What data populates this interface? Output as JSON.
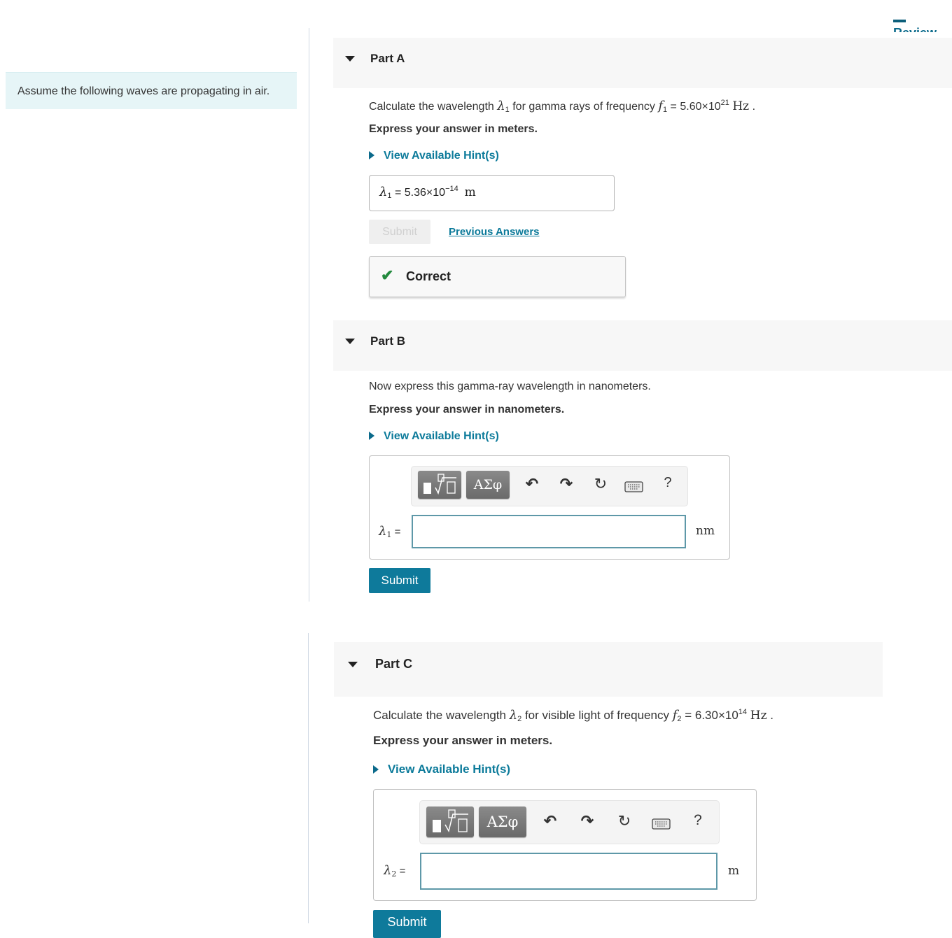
{
  "header": {
    "review_link": "Review"
  },
  "intro": {
    "text": "Assume the following waves are propagating in air."
  },
  "icons": {
    "expanded": "triangle-down",
    "hint": "triangle-right",
    "check": "✔",
    "templates": "fraction-root-template",
    "symbols": "ΑΣφ",
    "undo": "↶",
    "redo": "↷",
    "reset": "↻",
    "keyboard": "keyboard",
    "help": "?"
  },
  "colors": {
    "accent": "#0e7a9b",
    "correct": "#238a3e",
    "intro_bg": "#e6f5f7"
  },
  "parts": [
    {
      "title": "Part A",
      "question_pre": "Calculate the wavelength ",
      "var": "λ",
      "var_sub": "1",
      "question_mid": " for gamma rays of frequency ",
      "freq_var": "f",
      "freq_sub": "1",
      "freq_eq": " = 5.60×10",
      "freq_exp": "21",
      "freq_unit": "Hz",
      "question_end": " .",
      "instruction": "Express your answer in meters.",
      "hint_label": "View Available Hint(s)",
      "answer": {
        "label": "λ",
        "label_sub": "1",
        "eq": " = ",
        "mantissa": "5.36×10",
        "exponent": "−14",
        "unit": "m"
      },
      "submit_label": "Submit",
      "previous_answers_label": "Previous Answers",
      "feedback": "Correct"
    },
    {
      "title": "Part B",
      "question": "Now express this gamma-ray wavelength in nanometers.",
      "instruction": "Express your answer in nanometers.",
      "hint_label": "View Available Hint(s)",
      "input_label": "λ",
      "input_label_sub": "1",
      "input_eq": " =",
      "input_value": "",
      "unit": "nm",
      "submit_label": "Submit"
    },
    {
      "title": "Part C",
      "question_pre": "Calculate the wavelength ",
      "var": "λ",
      "var_sub": "2",
      "question_mid": " for visible light of frequency ",
      "freq_var": "f",
      "freq_sub": "2",
      "freq_eq": " = 6.30×10",
      "freq_exp": "14",
      "freq_unit": "Hz",
      "question_end": " .",
      "instruction": "Express your answer in meters.",
      "hint_label": "View Available Hint(s)",
      "input_label": "λ",
      "input_label_sub": "2",
      "input_eq": " =",
      "input_value": "",
      "unit": "m",
      "submit_label": "Submit"
    }
  ]
}
